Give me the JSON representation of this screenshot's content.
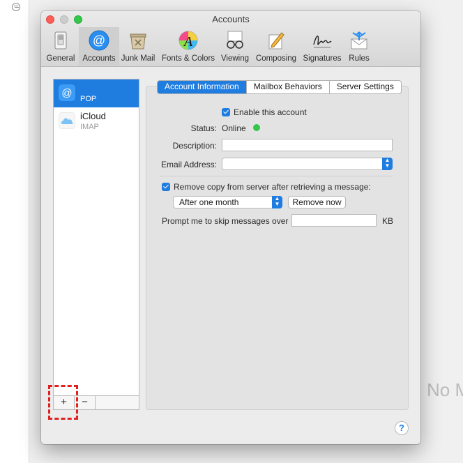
{
  "background": {
    "placeholder_text": "No M"
  },
  "window": {
    "title": "Accounts"
  },
  "toolbar": {
    "items": [
      {
        "label": "General",
        "icon": "switch-icon"
      },
      {
        "label": "Accounts",
        "icon": "at-sign-icon",
        "selected": true
      },
      {
        "label": "Junk Mail",
        "icon": "trash-bin-icon"
      },
      {
        "label": "Fonts & Colors",
        "icon": "color-font-icon"
      },
      {
        "label": "Viewing",
        "icon": "glasses-icon"
      },
      {
        "label": "Composing",
        "icon": "pencil-paper-icon"
      },
      {
        "label": "Signatures",
        "icon": "signature-icon"
      },
      {
        "label": "Rules",
        "icon": "rules-envelope-icon"
      }
    ]
  },
  "accounts": {
    "items": [
      {
        "name": "",
        "type": "POP",
        "icon": "at-sign-icon",
        "selected": true
      },
      {
        "name": "iCloud",
        "type": "IMAP",
        "icon": "cloud-icon"
      }
    ],
    "add_label": "+",
    "remove_label": "−"
  },
  "tabs": [
    "Account Information",
    "Mailbox Behaviors",
    "Server Settings"
  ],
  "form": {
    "enable_label": "Enable this account",
    "status_label": "Status:",
    "status_value": "Online",
    "description_label": "Description:",
    "description_value": "",
    "email_label": "Email Address:",
    "email_value": "",
    "remove_copy_label": "Remove copy from server after retrieving a message:",
    "remove_when_value": "After one month",
    "remove_now_label": "Remove now",
    "prompt_label": "Prompt me to skip messages over",
    "prompt_value": "",
    "prompt_unit": "KB"
  },
  "help_label": "?",
  "colors": {
    "accent": "#1f7de0",
    "online": "#35c549",
    "highlight": "#e02020"
  }
}
